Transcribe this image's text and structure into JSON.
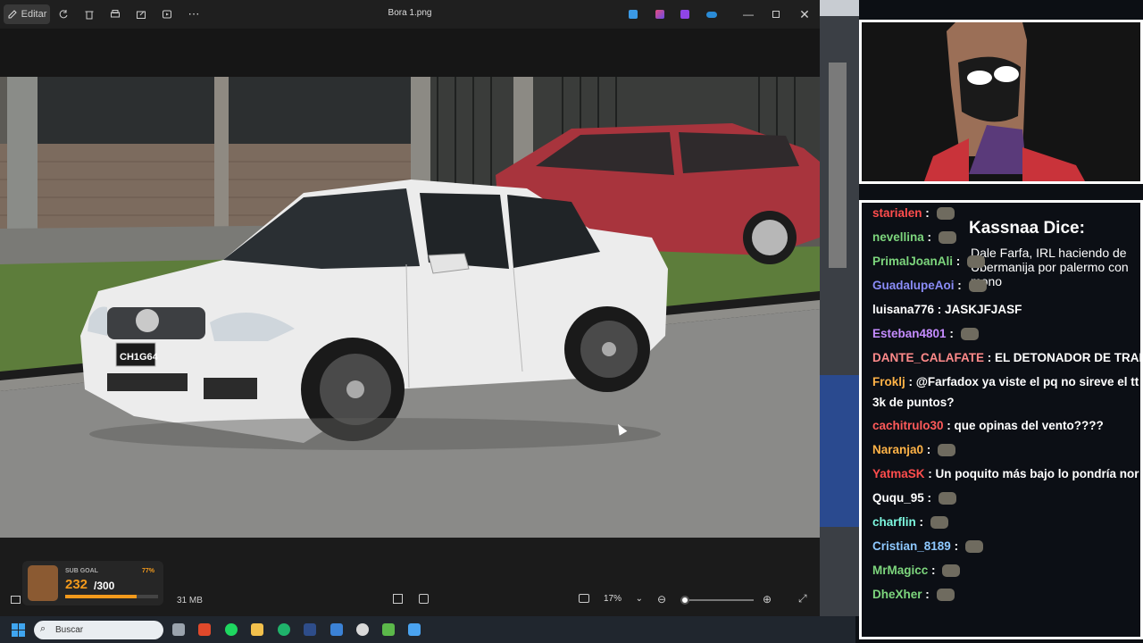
{
  "viewer": {
    "title": "Bora 1.png",
    "edit_label": "Editar",
    "file_size": "31 MB",
    "zoom": "17%",
    "zoom_slider_level": 0.0
  },
  "taskbar": {
    "search_placeholder": "Buscar"
  },
  "sub_goal": {
    "label": "SUB GOAL",
    "percent": "77%",
    "current": "232",
    "total": "/300",
    "progress": 0.77
  },
  "overlay_banner": {
    "title": "Kassnaa Dice:",
    "message": "Dale Farfa, IRL haciendo de Ubermanija por palermo con mono"
  },
  "chat": [
    {
      "user": "starialen",
      "color": "#ff4d4d",
      "text": ""
    },
    {
      "user": "nevellina",
      "color": "#7dd67d",
      "text": ""
    },
    {
      "user": "PrimalJoanAli",
      "color": "#7dd67d",
      "text": ""
    },
    {
      "user": "GuadalupeAoi",
      "color": "#8a8cf7",
      "text": ""
    },
    {
      "user": "luisana776",
      "color": "#ffffff",
      "text": "JASKJFJASF"
    },
    {
      "user": "Esteban4801",
      "color": "#c58cff",
      "text": ""
    },
    {
      "user": "DANTE_CALAFATE",
      "color": "#ff8a8a",
      "text": "EL DETONADOR DE TRAI"
    },
    {
      "user": "Froklj",
      "color": "#ffb347",
      "text": "@Farfadox ya viste el pq no sireve el tt"
    },
    {
      "user": "",
      "color": "#ffffff",
      "text": "3k de puntos?"
    },
    {
      "user": "cachitrulo30",
      "color": "#ff5a5a",
      "text": "que opinas del vento????"
    },
    {
      "user": "Naranja0",
      "color": "#ffb347",
      "text": ""
    },
    {
      "user": "YatmaSK",
      "color": "#ff4d4d",
      "text": "Un poquito más bajo lo pondría nor"
    },
    {
      "user": "Ququ_95",
      "color": "#ffffff",
      "text": ""
    },
    {
      "user": "charflin",
      "color": "#7df7df",
      "text": ""
    },
    {
      "user": "Cristian_8189",
      "color": "#8ec8ff",
      "text": ""
    },
    {
      "user": "MrMagicc",
      "color": "#7dd67d",
      "text": ""
    },
    {
      "user": "DheXher",
      "color": "#7dd67d",
      "text": ""
    }
  ],
  "colors": {
    "accent": "#3b82d6",
    "progress": "#f39a1c"
  }
}
